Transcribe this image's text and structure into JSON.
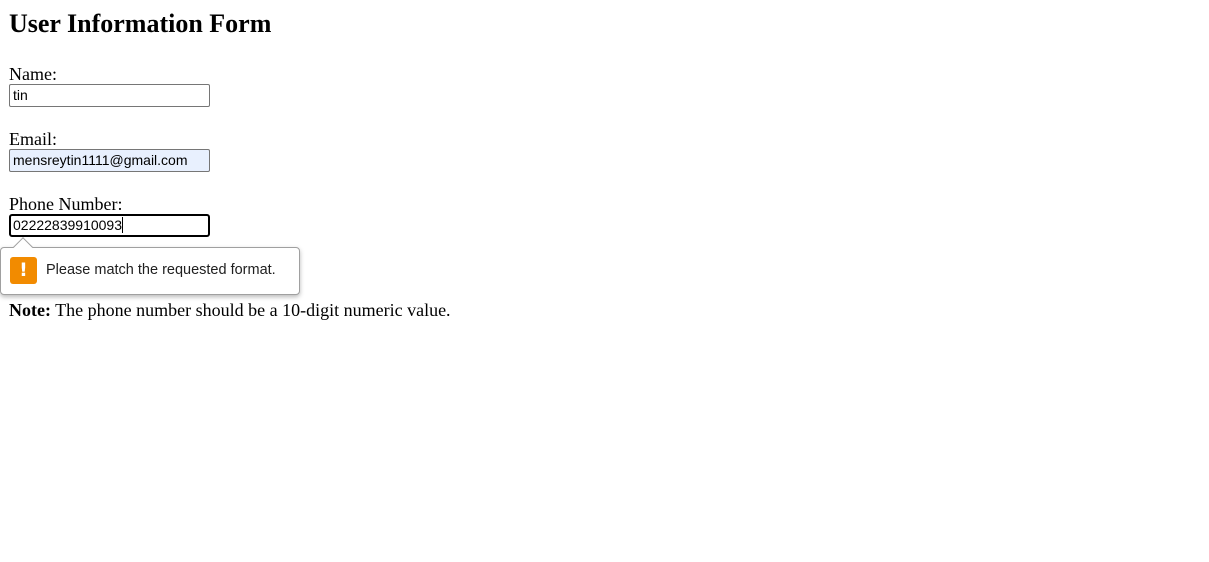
{
  "form": {
    "title": "User Information Form",
    "name_label": "Name:",
    "name_value": "tin",
    "email_label": "Email:",
    "email_value": "mensreytin1111@gmail.com",
    "phone_label": "Phone Number:",
    "phone_value": "02222839910093"
  },
  "validation_tooltip": {
    "icon": "warning-icon",
    "icon_glyph": "!",
    "icon_color": "#f28b00",
    "message": "Please match the requested format."
  },
  "note": {
    "label": "Note:",
    "text": " The phone number should be a 10-digit numeric value."
  }
}
